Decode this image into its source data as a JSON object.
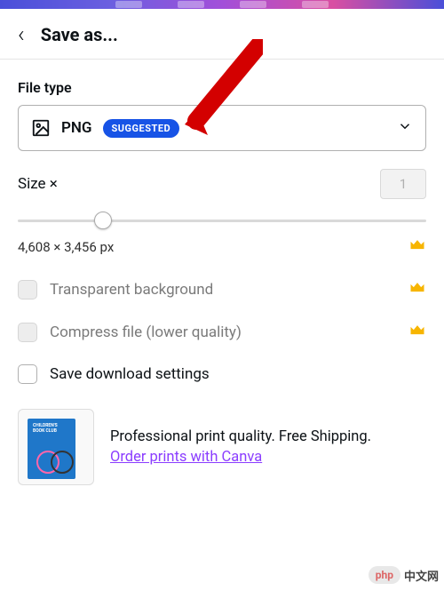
{
  "header": {
    "title": "Save as..."
  },
  "file_type": {
    "label": "File type",
    "selected": "PNG",
    "badge": "SUGGESTED"
  },
  "size": {
    "label": "Size ×",
    "multiplier": "1",
    "dimensions": "4,608 × 3,456 px"
  },
  "options": {
    "transparent": "Transparent background",
    "compress": "Compress file (lower quality)",
    "save_settings": "Save download settings"
  },
  "promo": {
    "thumb_title": "CHILDREN'S\nBOOK CLUB",
    "line1": "Professional print quality. Free Shipping.",
    "line2": "Order prints with Canva"
  },
  "watermark": {
    "php": "php",
    "cn": "中文网"
  }
}
